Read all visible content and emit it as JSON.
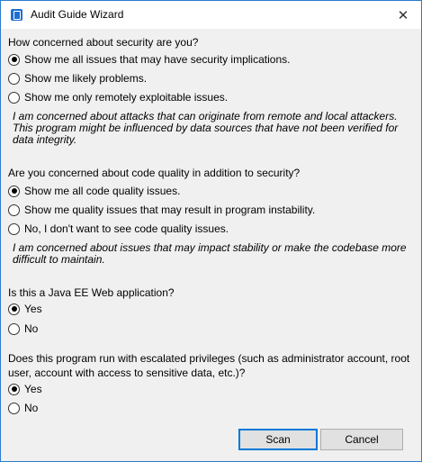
{
  "window": {
    "title": "Audit Guide Wizard",
    "close_glyph": "✕"
  },
  "security": {
    "question": "How concerned about security are you?",
    "options": [
      {
        "label": "Show me all issues that may have security implications.",
        "selected": true
      },
      {
        "label": "Show me likely problems.",
        "selected": false
      },
      {
        "label": "Show me only remotely exploitable issues.",
        "selected": false
      }
    ],
    "note": "I am concerned about attacks that can originate from remote and local attackers. This program might be influenced by data sources that have not been verified for data integrity."
  },
  "quality": {
    "question": "Are you concerned about code quality in addition to security?",
    "options": [
      {
        "label": "Show me all code quality issues.",
        "selected": true
      },
      {
        "label": "Show me quality issues that may result in program instability.",
        "selected": false
      },
      {
        "label": "No, I don't want to see code quality issues.",
        "selected": false
      }
    ],
    "note": "I am concerned about issues that may impact stability or make the codebase more difficult to maintain."
  },
  "javaee": {
    "question": "Is this a Java EE Web application?",
    "options": [
      {
        "label": "Yes",
        "selected": true
      },
      {
        "label": "No",
        "selected": false
      }
    ]
  },
  "privileges": {
    "question": "Does this program run with escalated privileges (such as administrator account, root user, account with access to sensitive data, etc.)?",
    "options": [
      {
        "label": "Yes",
        "selected": true
      },
      {
        "label": "No",
        "selected": false
      }
    ]
  },
  "buttons": {
    "scan": "Scan",
    "cancel": "Cancel"
  },
  "colors": {
    "accent": "#0078d7",
    "title_icon": "#1c6fd0"
  }
}
